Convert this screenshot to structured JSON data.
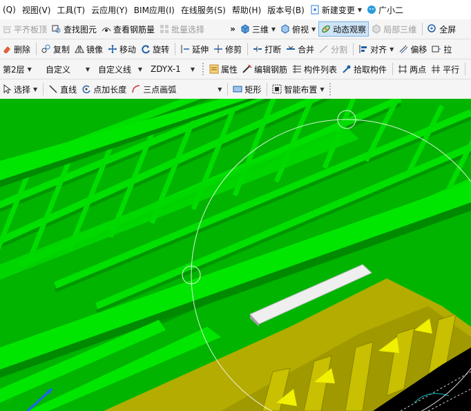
{
  "menu": [
    "(Q)",
    "视图(V)",
    "工具(T)",
    "云应用(Y)",
    "BIM应用(I)",
    "在线服务(S)",
    "帮助(H)",
    "版本号(B)"
  ],
  "menu_new_change": "新建变更",
  "menu_assistant": "广小二",
  "tb1": {
    "align_slab_top": "平齐板顶",
    "find_element": "查找图元",
    "view_rebar": "查看钢筋量",
    "batch_select": "批量选择",
    "more": "»",
    "view_3d": "三维",
    "top_view": "俯视",
    "dynamic_observe": "动态观察",
    "local_3d": "局部三维",
    "fullscreen": "全屏"
  },
  "tb2": {
    "delete": "删除",
    "copy": "复制",
    "mirror": "镜像",
    "move": "移动",
    "rotate": "旋转",
    "extend": "延伸",
    "trim": "修剪",
    "break": "打断",
    "merge": "合并",
    "split": "分割",
    "align": "对齐",
    "offset": "偏移",
    "stretch": "拉"
  },
  "tb3": {
    "floor": "第2层",
    "custom": "自定义",
    "custom_line": "自定义线",
    "component": "ZDYX-1",
    "properties": "属性",
    "edit_rebar": "编辑钢筋",
    "component_list": "构件列表",
    "pick_component": "拾取构件",
    "two_points": "两点",
    "parallel": "平行"
  },
  "tb4": {
    "select": "选择",
    "line": "直线",
    "point_length": "点加长度",
    "three_point_arc": "三点画弧",
    "rectangle": "矩形",
    "smart_layout": "智能布置"
  },
  "colors": {
    "slab_green": "#00b400",
    "beam_green": "#00e000",
    "wall_olive": "#b8b000",
    "triangle_yellow": "#f0f000",
    "selected_white": "#e8e8e8"
  }
}
